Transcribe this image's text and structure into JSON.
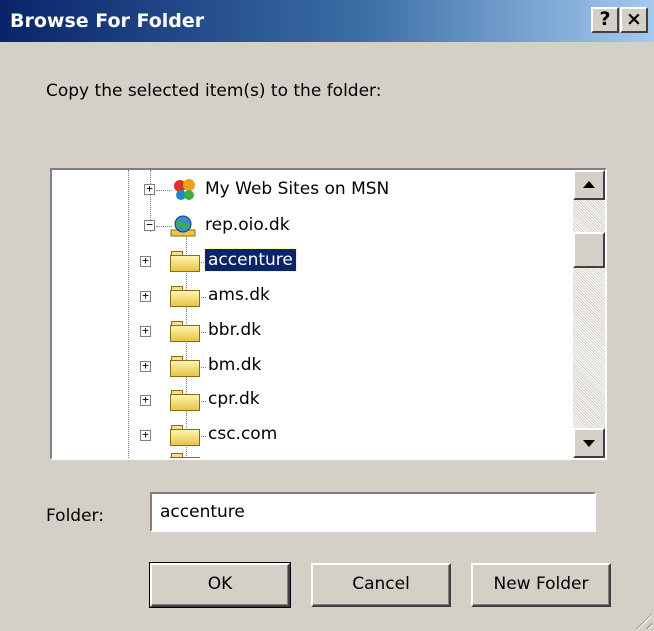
{
  "window": {
    "title": "Browse For Folder",
    "help_label": "?",
    "close_label": "×"
  },
  "prompt": "Copy the selected item(s) to the folder:",
  "tree": {
    "nodes": [
      {
        "label": "My Web Sites on MSN",
        "icon": "msn-butterfly-icon",
        "expander": "+"
      },
      {
        "label": "rep.oio.dk",
        "icon": "web-folder-globe-icon",
        "expander": "−"
      },
      {
        "label": "accenture",
        "icon": "folder-icon",
        "expander": "+",
        "selected": true
      },
      {
        "label": "ams.dk",
        "icon": "folder-icon",
        "expander": "+"
      },
      {
        "label": "bbr.dk",
        "icon": "folder-icon",
        "expander": "+"
      },
      {
        "label": "bm.dk",
        "icon": "folder-icon",
        "expander": "+"
      },
      {
        "label": "cpr.dk",
        "icon": "folder-icon",
        "expander": "+"
      },
      {
        "label": "csc.com",
        "icon": "folder-icon",
        "expander": "+"
      }
    ]
  },
  "folder_field": {
    "label": "Folder:",
    "value": "accenture"
  },
  "buttons": {
    "ok": "OK",
    "cancel": "Cancel",
    "new_folder": "New Folder"
  },
  "colors": {
    "titlebar_start": "#0a246a",
    "titlebar_end": "#a6caf0",
    "selection": "#0a246a",
    "face": "#d4d0c8"
  }
}
